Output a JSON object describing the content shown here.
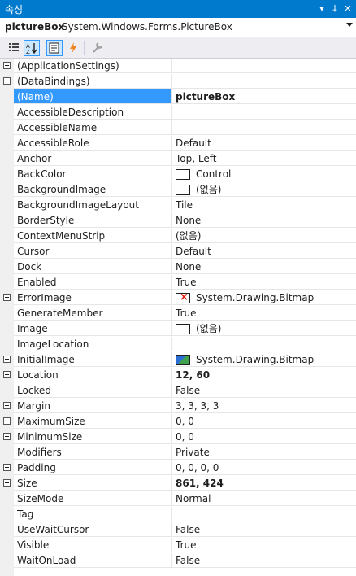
{
  "window": {
    "title": "속성",
    "buttons": [
      "▾",
      "‡",
      "✕"
    ]
  },
  "object_selector": {
    "name": "pictureBox",
    "type": "System.Windows.Forms.PictureBox"
  },
  "toolbar": {
    "buttons": [
      "categorized-icon",
      "alphabetical-icon",
      "properties-icon",
      "events-icon",
      "property-pages-icon"
    ]
  },
  "properties": [
    {
      "name": "(ApplicationSettings)",
      "value": "",
      "expandable": true
    },
    {
      "name": "(DataBindings)",
      "value": "",
      "expandable": true
    },
    {
      "name": "(Name)",
      "value": "pictureBox",
      "bold": true,
      "selected": true
    },
    {
      "name": "AccessibleDescription",
      "value": ""
    },
    {
      "name": "AccessibleName",
      "value": ""
    },
    {
      "name": "AccessibleRole",
      "value": "Default"
    },
    {
      "name": "Anchor",
      "value": "Top, Left"
    },
    {
      "name": "BackColor",
      "value": "Control",
      "swatch": "color"
    },
    {
      "name": "BackgroundImage",
      "value": "(없음)",
      "swatch": "empty"
    },
    {
      "name": "BackgroundImageLayout",
      "value": "Tile"
    },
    {
      "name": "BorderStyle",
      "value": "None"
    },
    {
      "name": "ContextMenuStrip",
      "value": "(없음)"
    },
    {
      "name": "Cursor",
      "value": "Default"
    },
    {
      "name": "Dock",
      "value": "None"
    },
    {
      "name": "Enabled",
      "value": "True"
    },
    {
      "name": "ErrorImage",
      "value": "System.Drawing.Bitmap",
      "swatch": "error",
      "expandable": true
    },
    {
      "name": "GenerateMember",
      "value": "True"
    },
    {
      "name": "Image",
      "value": "(없음)",
      "swatch": "empty"
    },
    {
      "name": "ImageLocation",
      "value": ""
    },
    {
      "name": "InitialImage",
      "value": "System.Drawing.Bitmap",
      "swatch": "image",
      "expandable": true
    },
    {
      "name": "Location",
      "value": "12, 60",
      "bold": true,
      "expandable": true
    },
    {
      "name": "Locked",
      "value": "False"
    },
    {
      "name": "Margin",
      "value": "3, 3, 3, 3",
      "expandable": true
    },
    {
      "name": "MaximumSize",
      "value": "0, 0",
      "expandable": true
    },
    {
      "name": "MinimumSize",
      "value": "0, 0",
      "expandable": true
    },
    {
      "name": "Modifiers",
      "value": "Private"
    },
    {
      "name": "Padding",
      "value": "0, 0, 0, 0",
      "expandable": true
    },
    {
      "name": "Size",
      "value": "861, 424",
      "bold": true,
      "expandable": true
    },
    {
      "name": "SizeMode",
      "value": "Normal"
    },
    {
      "name": "Tag",
      "value": ""
    },
    {
      "name": "UseWaitCursor",
      "value": "False"
    },
    {
      "name": "Visible",
      "value": "True"
    },
    {
      "name": "WaitOnLoad",
      "value": "False"
    }
  ]
}
